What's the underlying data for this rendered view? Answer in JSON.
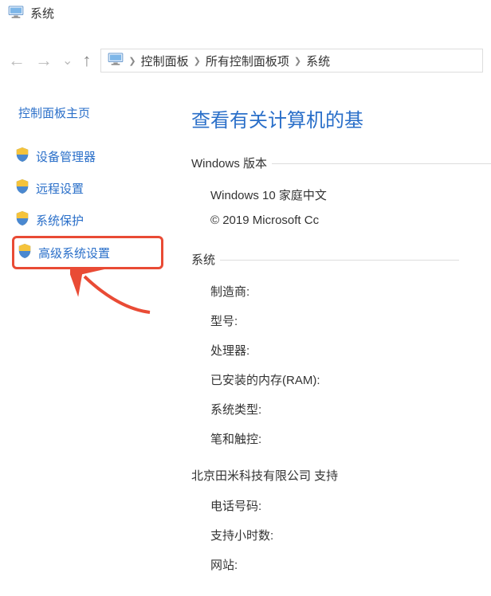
{
  "titlebar": {
    "title": "系统"
  },
  "breadcrumb": {
    "items": [
      "控制面板",
      "所有控制面板项",
      "系统"
    ]
  },
  "sidebar": {
    "header": "控制面板主页",
    "items": [
      {
        "label": "设备管理器"
      },
      {
        "label": "远程设置"
      },
      {
        "label": "系统保护"
      },
      {
        "label": "高级系统设置"
      }
    ]
  },
  "main": {
    "heading": "查看有关计算机的基",
    "windows_section": {
      "label": "Windows 版本",
      "edition": "Windows 10 家庭中文",
      "copyright": "© 2019 Microsoft Cc"
    },
    "system_section": {
      "label": "系统",
      "rows": [
        "制造商:",
        "型号:",
        "处理器:",
        "已安装的内存(RAM):",
        "系统类型:",
        "笔和触控:"
      ]
    },
    "support_section": {
      "header": "北京田米科技有限公司 支持",
      "rows": [
        "电话号码:",
        "支持小时数:",
        "网站:"
      ]
    }
  }
}
